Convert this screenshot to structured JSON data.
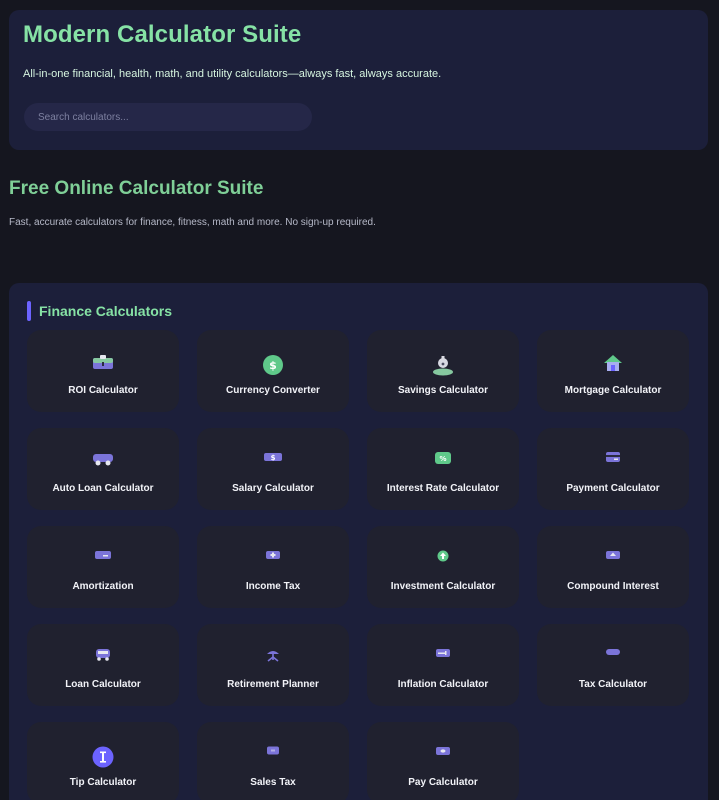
{
  "header": {
    "title": "Modern Calculator Suite",
    "tagline": "All-in-one financial, health, math, and utility calculators—always fast, always accurate.",
    "search_placeholder": "Search calculators..."
  },
  "intro": {
    "title": "Free Online Calculator Suite",
    "text": "Fast, accurate calculators for finance, fitness, math and more. No sign-up required."
  },
  "finance": {
    "title": "Finance Calculators",
    "cards": [
      {
        "label": "ROI Calculator",
        "icon": "briefcase-icon"
      },
      {
        "label": "Currency Converter",
        "icon": "dollar-coin-icon"
      },
      {
        "label": "Savings Calculator",
        "icon": "piggy-bank-icon"
      },
      {
        "label": "Mortgage Calculator",
        "icon": "house-icon"
      },
      {
        "label": "Auto Loan Calculator",
        "icon": "car-icon"
      },
      {
        "label": "Salary Calculator",
        "icon": "cash-icon"
      },
      {
        "label": "Interest Rate Calculator",
        "icon": "percent-icon"
      },
      {
        "label": "Payment Calculator",
        "icon": "credit-card-icon"
      },
      {
        "label": "Amortization",
        "icon": "ledger-icon"
      },
      {
        "label": "Income Tax",
        "icon": "receipt-icon"
      },
      {
        "label": "Investment Calculator",
        "icon": "growth-icon"
      },
      {
        "label": "Compound Interest",
        "icon": "chart-icon"
      },
      {
        "label": "Loan Calculator",
        "icon": "vehicle-icon"
      },
      {
        "label": "Retirement Planner",
        "icon": "umbrella-icon"
      },
      {
        "label": "Inflation Calculator",
        "icon": "trend-icon"
      },
      {
        "label": "Tax Calculator",
        "icon": "tag-icon"
      },
      {
        "label": "Tip Calculator",
        "icon": "tip-icon"
      },
      {
        "label": "Sales Tax",
        "icon": "sales-icon"
      },
      {
        "label": "Pay Calculator",
        "icon": "wallet-icon"
      }
    ]
  },
  "colors": {
    "accent_green": "#86e2a5",
    "accent_purple": "#6c63ff",
    "panel_bg": "#1c1f3a",
    "card_bg": "#20212f",
    "page_bg": "#15161f"
  }
}
